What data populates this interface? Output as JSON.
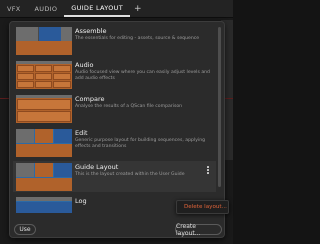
{
  "tabs": [
    {
      "label": "VFX",
      "active": false
    },
    {
      "label": "AUDIO",
      "active": false
    },
    {
      "label": "GUIDE LAYOUT",
      "active": true
    }
  ],
  "add_tab_label": "+",
  "layouts": [
    {
      "title": "Assemble",
      "description": "The essentials for editing - assets, source & sequence"
    },
    {
      "title": "Audio",
      "description": "Audio focused view where you can easily adjust levels and add audio effects"
    },
    {
      "title": "Compare",
      "description": "Analyse the results of a QScan file comparison"
    },
    {
      "title": "Edit",
      "description": "Generic purpose layout for building sequences, applying effects and transitions"
    },
    {
      "title": "Guide Layout",
      "description": "This is the layout created within the User Guide"
    },
    {
      "title": "Log",
      "description": ""
    }
  ],
  "context_menu": {
    "delete_label": "Delete layout..."
  },
  "footer": {
    "use_label": "Use",
    "create_label": "Create layout..."
  },
  "colors": {
    "accent_orange": "#b0622b",
    "thumb_blue": "#2d6aa5",
    "danger_text": "#e0643a"
  }
}
